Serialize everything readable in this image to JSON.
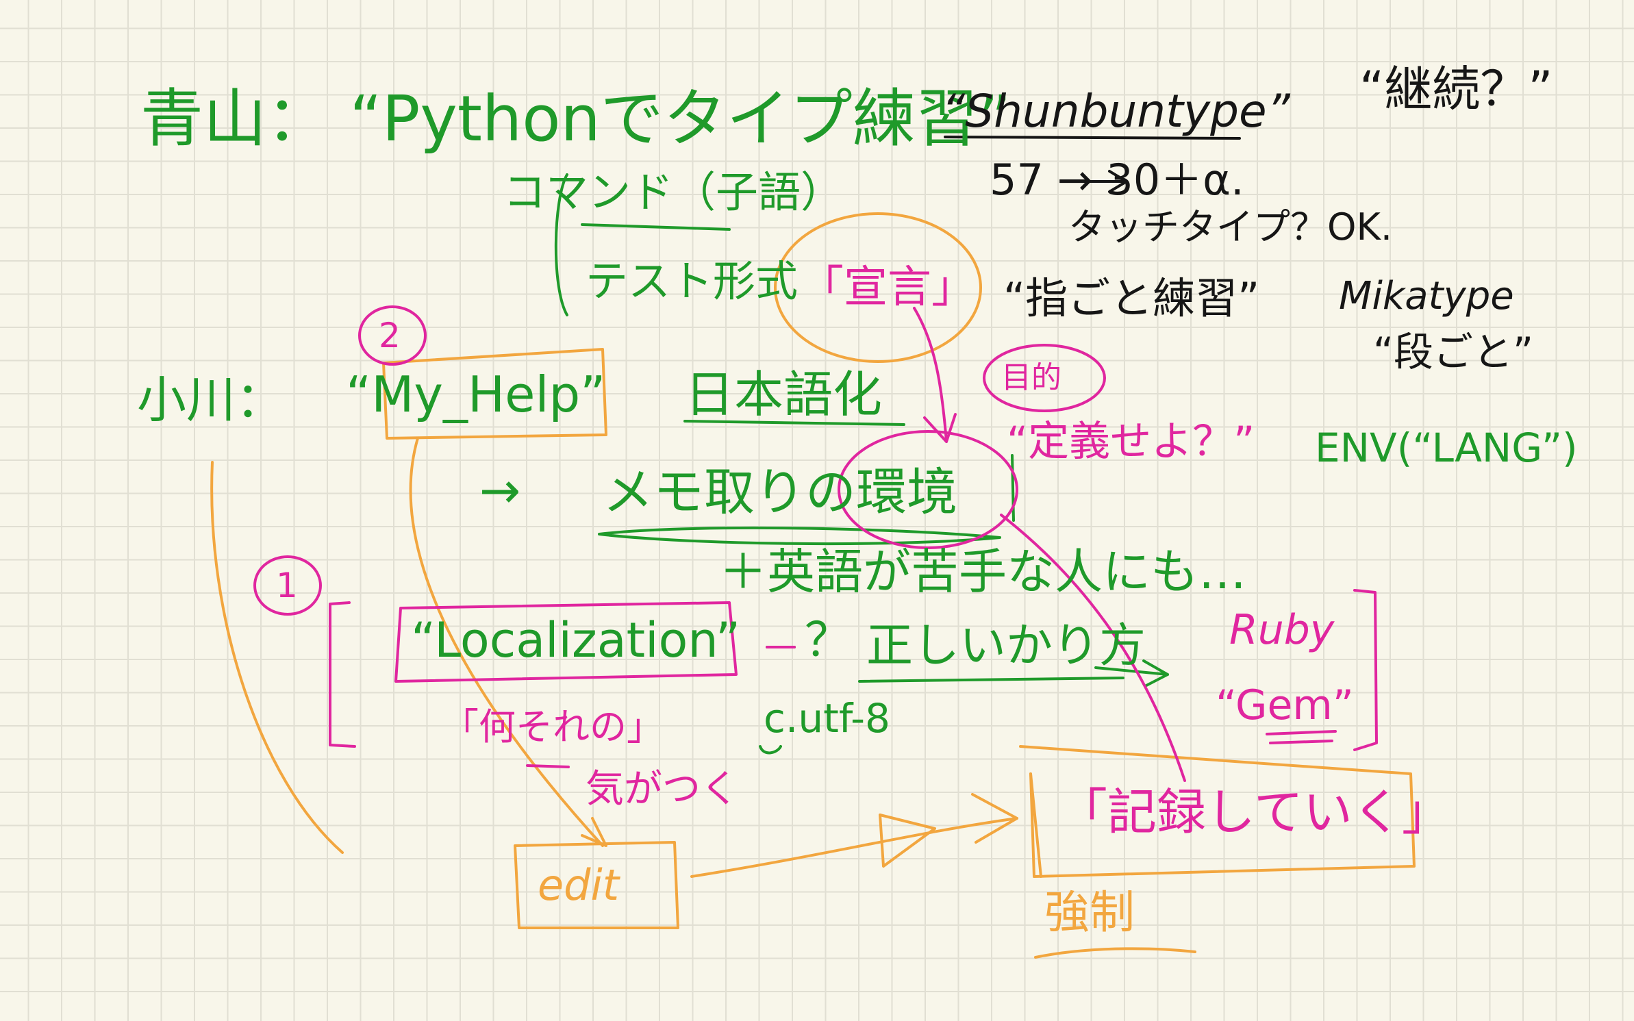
{
  "notes": {
    "aoyama_line": "青山： “Pythonでタイプ練習”",
    "command": "コマンド（子語）",
    "test_format": "テスト形式",
    "sengen": "「宣言」",
    "shunbun": "“Shunbuntype”",
    "keizoku": "“継続？”",
    "count": "57 → 30＋α.",
    "touch": "タッチタイプ？OK.",
    "yubi": "“指ごと練習”",
    "mikatype": "Mikatype",
    "dan": "“段ごと”",
    "ogawa": "小川：",
    "myhelp": "“My_Help”",
    "nihongo": "日本語化",
    "mokuteki": "目的",
    "teigi": "“定義せよ？”",
    "env": "ENV(“LANG”)",
    "arrow": "→",
    "memo": "メモ取りの環境",
    "eigo": "＋英語が苦手な人にも…",
    "num1": "1",
    "num2": "2",
    "localization": "“Localization”",
    "q": "？",
    "tadashii": "正しいかり方",
    "ruby": "Ruby",
    "gem": "“Gem”",
    "nanisore": "「何それの」",
    "utf8": "c.utf-8",
    "kigatsuku": "気がつく",
    "kiroku": "「記録していく」",
    "edit": "edit",
    "kyouhan": "強制"
  }
}
